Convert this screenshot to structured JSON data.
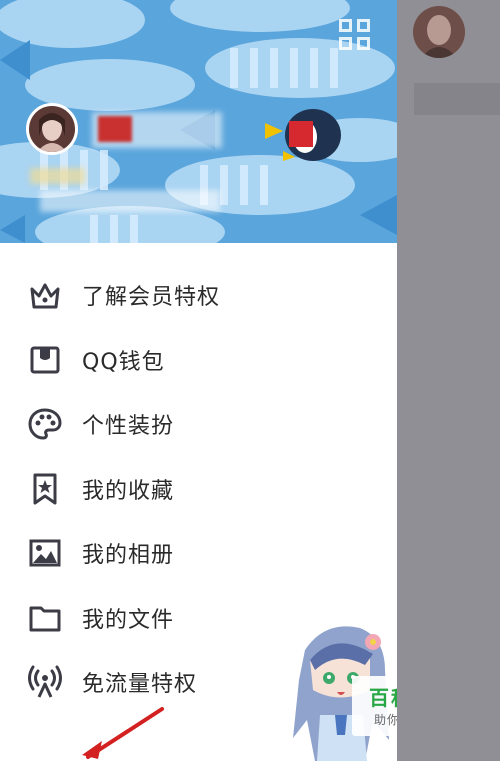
{
  "header": {
    "background_color": "#5aa5dc",
    "qr_icon": "qr-code-icon",
    "avatar_icon": "user-avatar"
  },
  "menu": {
    "items": [
      {
        "label": "了解会员特权",
        "icon": "crown-icon"
      },
      {
        "label": "QQ钱包",
        "icon": "wallet-icon"
      },
      {
        "label": "个性装扮",
        "icon": "palette-icon"
      },
      {
        "label": "我的收藏",
        "icon": "bookmark-star-icon"
      },
      {
        "label": "我的相册",
        "icon": "image-icon"
      },
      {
        "label": "我的文件",
        "icon": "folder-icon"
      },
      {
        "label": "免流量特权",
        "icon": "broadcast-icon"
      }
    ]
  },
  "watermark": {
    "title": "百科全说",
    "subtitle": "助你轻松解决"
  },
  "colors": {
    "overlay": "#8f8f95",
    "icon": "#3c3c46",
    "text": "#2a2a2a",
    "watermark_green": "#2aa745"
  }
}
